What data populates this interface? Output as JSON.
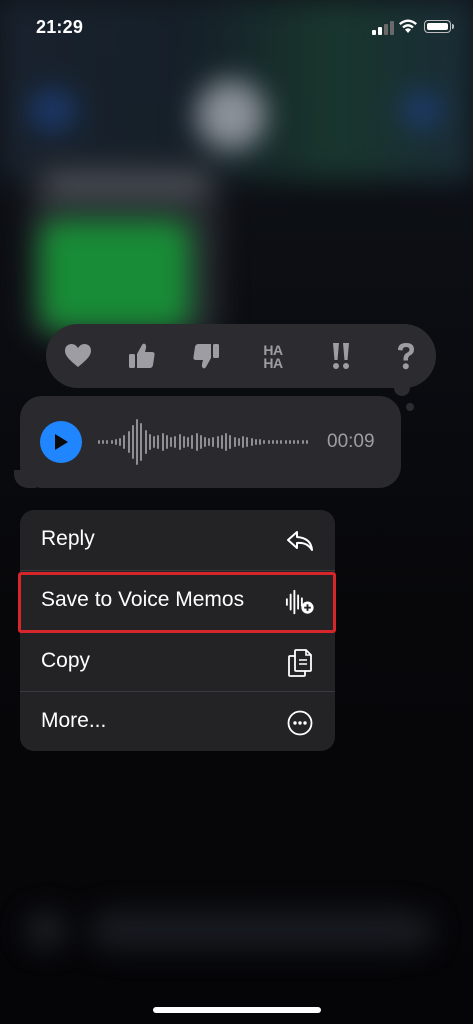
{
  "status_bar": {
    "time": "21:29",
    "signal_icon": "cellular-signal-icon",
    "wifi_icon": "wifi-icon",
    "battery_icon": "battery-full-icon"
  },
  "tapback": {
    "reactions": [
      {
        "name": "heart",
        "icon": "heart-icon"
      },
      {
        "name": "thumbs up",
        "icon": "thumbs-up-icon"
      },
      {
        "name": "thumbs down",
        "icon": "thumbs-down-icon"
      },
      {
        "name": "haha",
        "icon": "haha-icon",
        "line1": "HA",
        "line2": "HA"
      },
      {
        "name": "emphasize",
        "icon": "double-exclamation-icon",
        "glyph": "!!"
      },
      {
        "name": "question",
        "icon": "question-mark-icon",
        "glyph": "?"
      }
    ],
    "icon_color": "#9d9da3",
    "background": "#2c2c30"
  },
  "audio_message": {
    "duration": "00:09",
    "play_icon": "play-icon",
    "accent": "#1f86ff"
  },
  "context_menu": {
    "items": [
      {
        "label": "Reply",
        "icon": "reply-arrow-icon"
      },
      {
        "label": "Save to Voice Memos",
        "icon": "voice-memos-add-icon",
        "highlighted": true
      },
      {
        "label": "Copy",
        "icon": "copy-documents-icon"
      },
      {
        "label": "More...",
        "icon": "more-ellipsis-circle-icon"
      }
    ],
    "highlight_color": "#d6252b"
  }
}
